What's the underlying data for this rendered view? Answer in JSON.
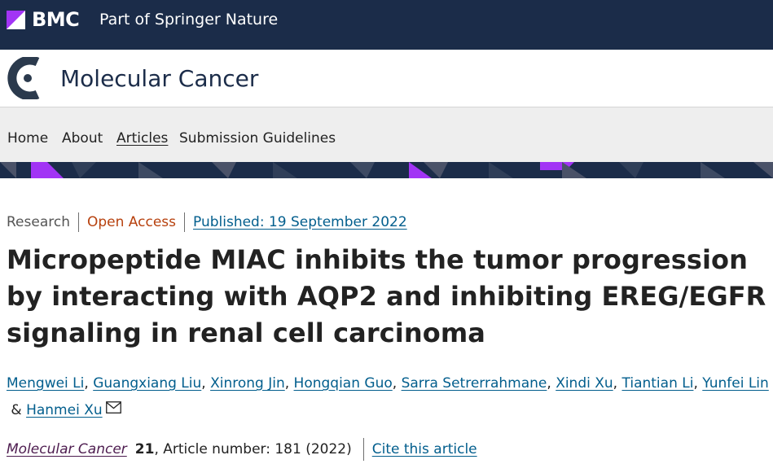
{
  "brand": {
    "logo_text": "BMC",
    "tagline": "Part of Springer Nature"
  },
  "journal": {
    "title": "Molecular Cancer"
  },
  "nav": {
    "items": [
      {
        "label": "Home"
      },
      {
        "label": "About"
      },
      {
        "label": "Articles",
        "active": true
      },
      {
        "label": "Submission Guidelines"
      }
    ]
  },
  "article": {
    "type": "Research",
    "access": "Open Access",
    "published": "Published: 19 September 2022",
    "title": "Micropeptide MIAC inhibits the tumor progression by interacting with AQP2 and inhibiting EREG/EGFR signaling in renal cell carcinoma",
    "authors": [
      "Mengwei Li",
      "Guangxiang Liu",
      "Xinrong Jin",
      "Hongqian Guo",
      "Sarra Setrerrahmane",
      "Xindi Xu",
      "Tiantian Li",
      "Yunfei Lin",
      "Hanmei Xu"
    ],
    "author_separator": ", ",
    "author_last_separator": " & ",
    "citation": {
      "journal": "Molecular Cancer",
      "volume": "21",
      "article_number": ", Article number: 181 (2022)",
      "cite_label": "Cite this article"
    }
  },
  "colors": {
    "brand_navy": "#1b2c49",
    "accent_purple": "#a234f5",
    "link_blue": "#025e8d",
    "open_access": "#b7410e"
  },
  "icons": {
    "email": "envelope-icon",
    "journal_logo": "molecular-cancer-logo-icon"
  }
}
